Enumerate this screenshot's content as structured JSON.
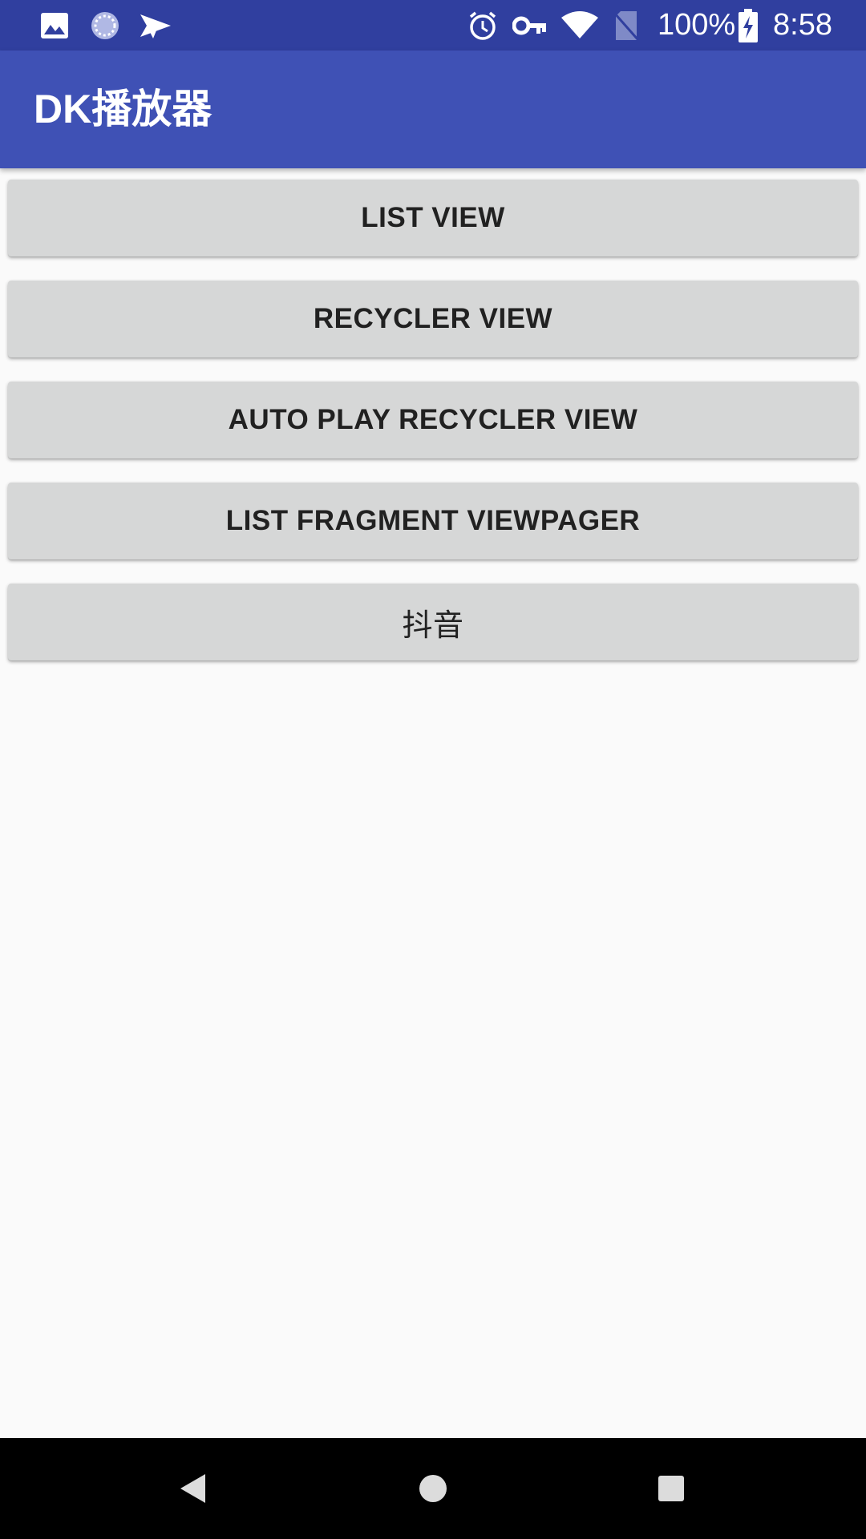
{
  "status_bar": {
    "battery_text": "100%",
    "time": "8:58",
    "left_icons": [
      "image-icon",
      "sync-icon",
      "send-icon"
    ],
    "right_icons": [
      "alarm-icon",
      "vpn-key-icon",
      "wifi-icon",
      "no-sim-icon",
      "battery-charging-icon"
    ],
    "background_color": "#303f9f"
  },
  "app_bar": {
    "title": "DK播放器",
    "background_color": "#3f51b5"
  },
  "buttons": [
    {
      "label": "LIST VIEW"
    },
    {
      "label": "RECYCLER VIEW"
    },
    {
      "label": "AUTO PLAY RECYCLER VIEW"
    },
    {
      "label": "LIST FRAGMENT VIEWPAGER"
    },
    {
      "label": "抖音"
    }
  ],
  "nav_bar": {
    "icons": [
      "back-icon",
      "home-icon",
      "recents-icon"
    ]
  }
}
